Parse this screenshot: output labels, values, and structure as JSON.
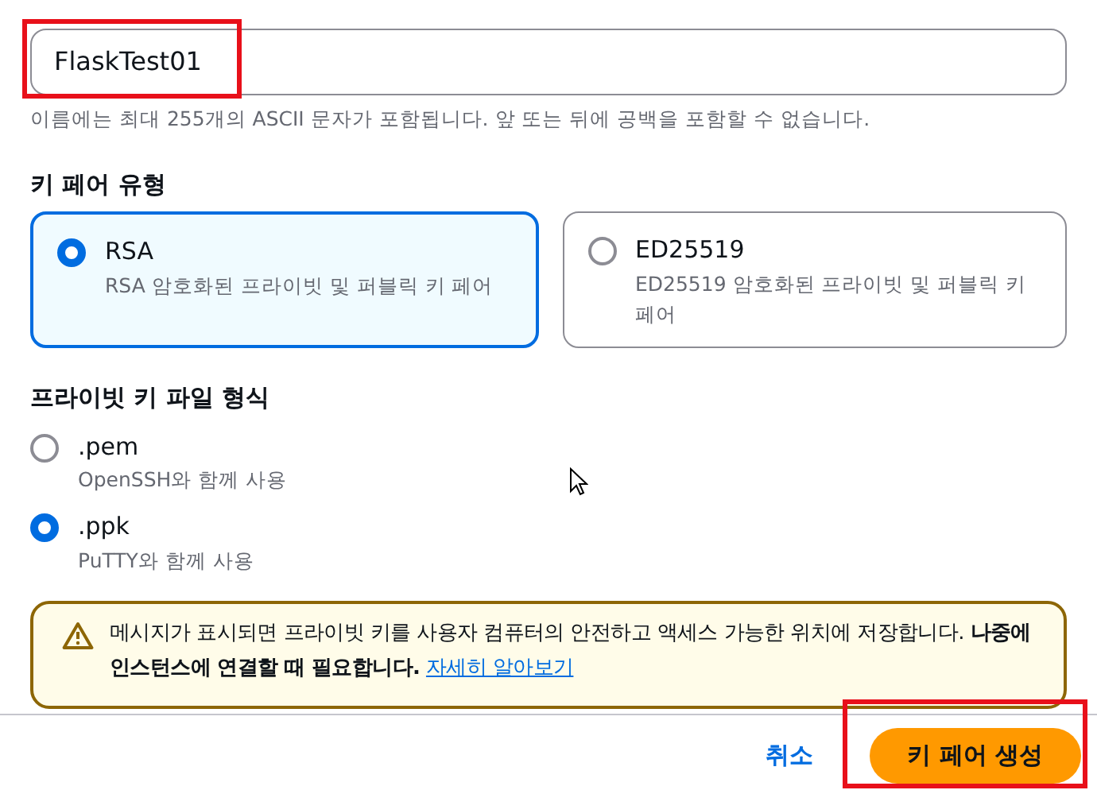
{
  "name_field": {
    "value": "FlaskTest01",
    "highlighted": true
  },
  "name_hint": "이름에는 최대 255개의 ASCII 문자가 포함됩니다. 앞 또는 뒤에 공백을 포함할 수 없습니다.",
  "key_pair_type": {
    "heading": "키 페어 유형",
    "options": [
      {
        "label": "RSA",
        "description": "RSA 암호화된 프라이빗 및 퍼블릭 키 페어",
        "selected": true
      },
      {
        "label": "ED25519",
        "description": "ED25519 암호화된 프라이빗 및 퍼블릭 키 페어",
        "selected": false
      }
    ]
  },
  "key_file_format": {
    "heading": "프라이빗 키 파일 형식",
    "options": [
      {
        "label": ".pem",
        "description": "OpenSSH와 함께 사용",
        "selected": false
      },
      {
        "label": ".ppk",
        "description": "PuTTY와 함께 사용",
        "selected": true
      }
    ]
  },
  "warning": {
    "text": "메시지가 표시되면 프라이빗 키를 사용자 컴퓨터의 안전하고 액세스 가능한 위치에 저장합니다. **나중에 인스턴스에 연결할 때 필요합니다.**",
    "link": "자세히 알아보기"
  },
  "footer": {
    "cancel": "취소",
    "create": {
      "label": "키 페어 생성",
      "highlighted": true
    }
  }
}
